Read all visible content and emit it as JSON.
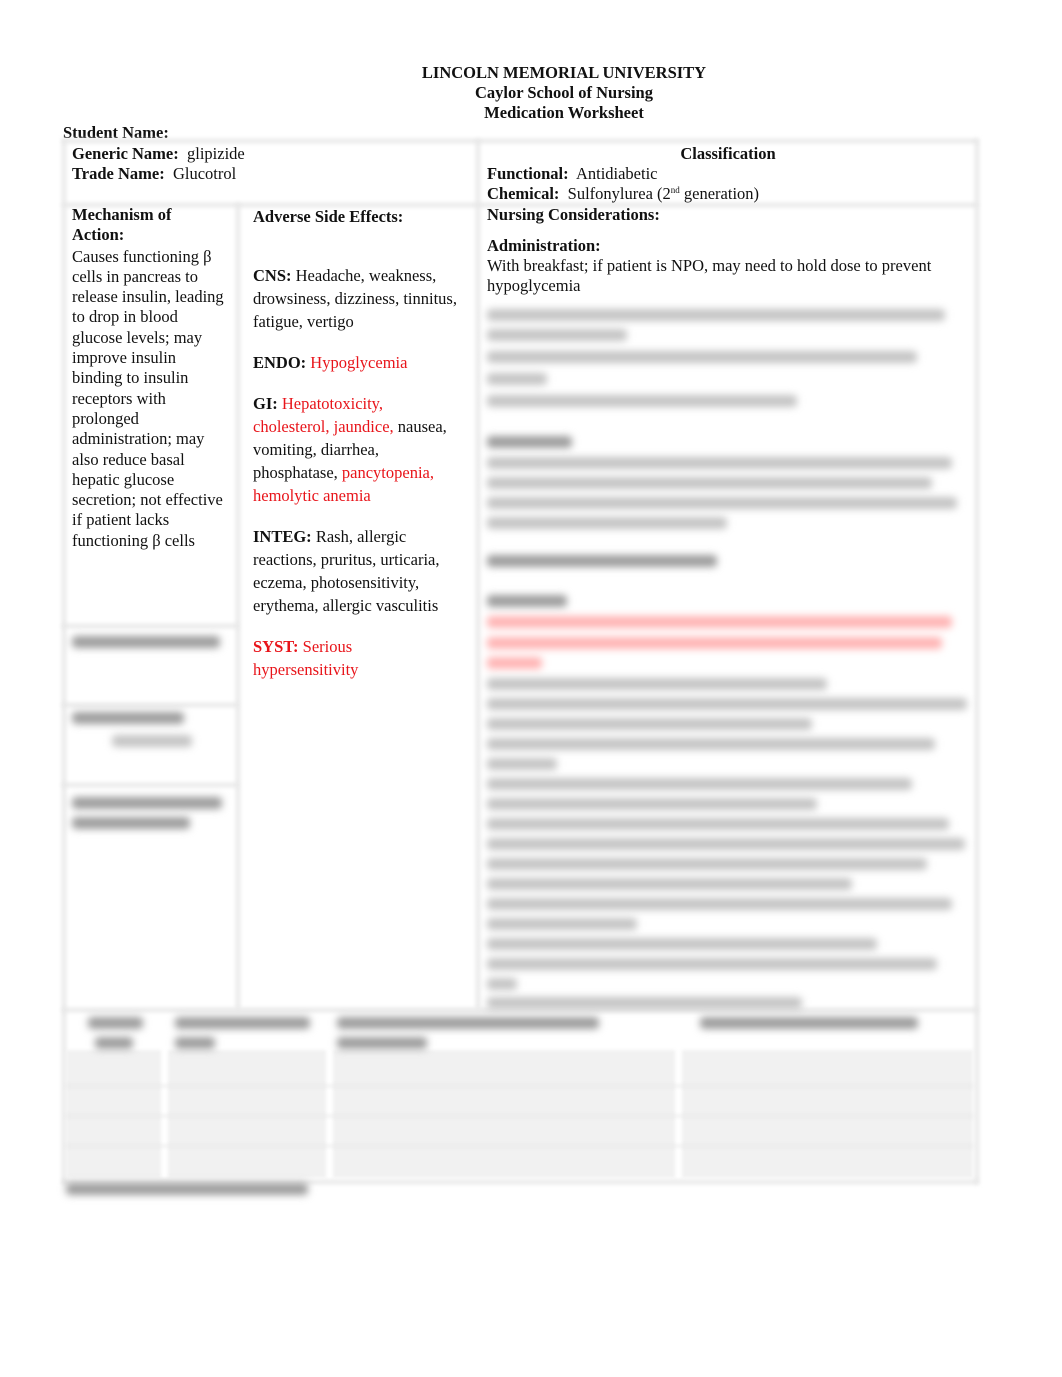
{
  "header": {
    "university": "LINCOLN MEMORIAL UNIVERSITY",
    "school": "Caylor School of Nursing",
    "worksheet_title": "Medication Worksheet"
  },
  "student": {
    "label": "Student Name:",
    "value": ""
  },
  "drug": {
    "generic_label": "Generic Name:",
    "generic_value": "glipizide",
    "trade_label": "Trade Name:",
    "trade_value": "Glucotrol"
  },
  "classification": {
    "heading": "Classification",
    "functional_label": "Functional:",
    "functional_value": "Antidiabetic",
    "chemical_label": "Chemical:",
    "chemical_value_pre": "Sulfonylurea (2",
    "chemical_sup": "nd",
    "chemical_value_post": " generation)"
  },
  "mechanism": {
    "heading_line1": "Mechanism of",
    "heading_line2": "Action:",
    "lines": [
      "Causes functioning β",
      "cells in pancreas to",
      "release insulin, leading",
      "to drop in blood",
      "glucose levels; may",
      "improve insulin",
      "binding to insulin",
      "receptors with",
      "prolonged",
      "administration; may",
      "also reduce basal",
      "hepatic glucose",
      "secretion; not effective",
      "if patient lacks",
      "functioning β cells"
    ]
  },
  "adverse": {
    "heading": "Adverse Side Effects:",
    "cns_label": "CNS:",
    "cns_lines": [
      "Headache, weakness,",
      "drowsiness, dizziness, tinnitus,",
      "fatigue, vertigo"
    ],
    "endo_label": "ENDO:",
    "endo_value": "Hypoglycemia",
    "gi_label": "GI:",
    "gi_red_1": "Hepatotoxicity,",
    "gi_red_2": "cholesterol, jaundice,",
    "gi_black_2": " nausea,",
    "gi_black_3": "vomiting, diarrhea,",
    "gi_black_4": "phosphatase, ",
    "gi_red_4": "pancytopenia,",
    "gi_red_5": "hemolytic anemia",
    "integ_label": "INTEG:",
    "integ_lines": [
      "Rash, allergic",
      "reactions, pruritus, urticaria,",
      "eczema, photosensitivity,",
      "erythema, allergic vasculitis"
    ],
    "syst_label": "SYST:",
    "syst_line1": "Serious",
    "syst_line2": "hypersensitivity"
  },
  "nursing": {
    "heading": "Nursing Considerations:",
    "admin_label": "Administration:",
    "admin_line1": "With breakfast; if patient is NPO, may need to hold dose to prevent",
    "admin_line2": "hypoglycemia"
  },
  "colors": {
    "alert_red": "#e8141a",
    "text": "#111111",
    "grid": "#e6e6e6",
    "blur_gray": "#c4c4c4",
    "blur_pink": "#ffb3b3"
  },
  "blurred_preview": true
}
